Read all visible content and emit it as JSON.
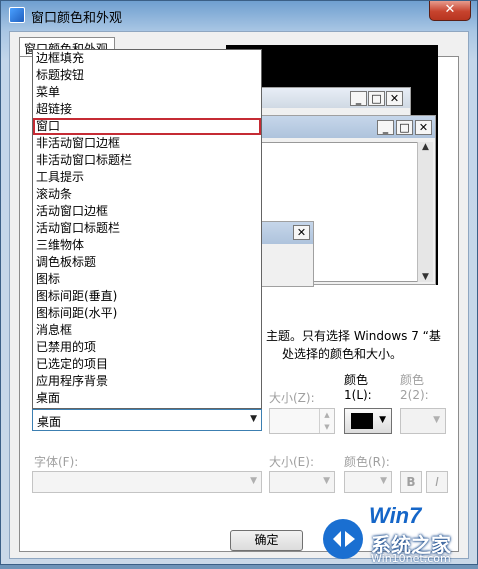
{
  "window": {
    "title": "窗口颜色和外观",
    "close": "✕"
  },
  "tabs": [
    {
      "label": "窗口颜色和外观"
    }
  ],
  "dropdown": {
    "items": [
      "边框填充",
      "标题按钮",
      "菜单",
      "超链接",
      "窗口",
      "非活动窗口边框",
      "非活动窗口标题栏",
      "工具提示",
      "滚动条",
      "活动窗口边框",
      "活动窗口标题栏",
      "三维物体",
      "调色板标题",
      "图标",
      "图标间距(垂直)",
      "图标间距(水平)",
      "消息框",
      "已禁用的项",
      "已选定的项目",
      "应用程序背景",
      "桌面"
    ],
    "highlighted": "窗口",
    "selected_value": "桌面"
  },
  "description": {
    "line1": "主题。只有选择 Windows 7 “基",
    "line2": "处选择的颜色和大小。"
  },
  "item_row": {
    "size_label": "大小(Z):",
    "color1_label": "颜色",
    "color1_sub": "1(L):",
    "color2_label": "颜色",
    "color2_sub": "2(2):",
    "color1_value": "#000000"
  },
  "font_row": {
    "font_label": "字体(F):",
    "size_label": "大小(E):",
    "color_label": "颜色(R):",
    "bold": "B",
    "italic": "I"
  },
  "buttons": {
    "ok": "确定"
  },
  "preview": {
    "close_glyph": "✕"
  },
  "watermark": {
    "brand": "系统之家",
    "url": "Win10net.com",
    "logo": "Win7"
  }
}
